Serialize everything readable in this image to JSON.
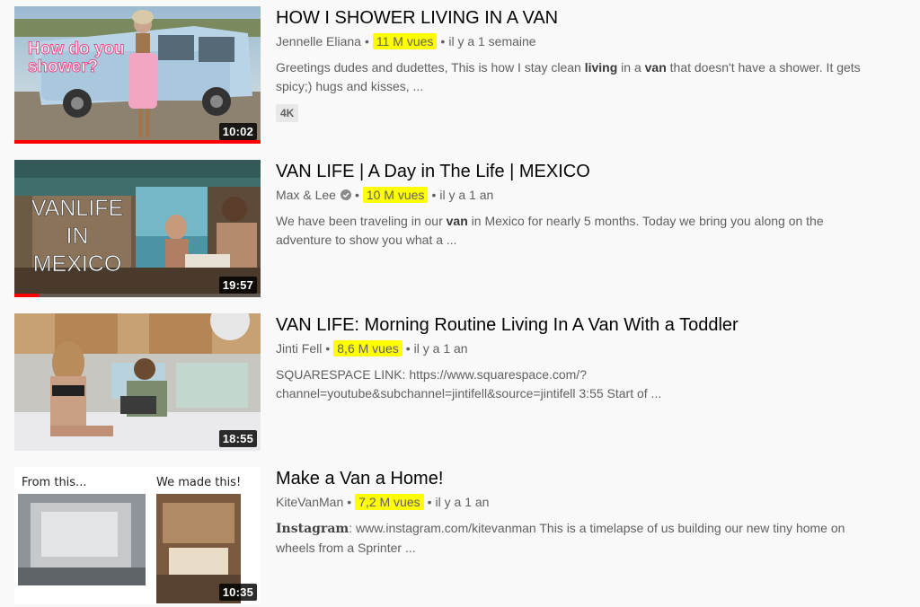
{
  "results": [
    {
      "title": "HOW I SHOWER LIVING IN A VAN",
      "channel": "Jennelle Eliana",
      "verified": false,
      "views": "11 M vues",
      "age": "il y a 1 semaine",
      "desc_parts": [
        "Greetings dudes and dudettes, This is how I stay clean ",
        "living",
        " in a ",
        "van",
        " that doesn't have a shower. It gets spicy;) hugs and kisses, ..."
      ],
      "badge": "4K",
      "duration": "10:02",
      "progress": 1.0,
      "thumb_caption": "How do you shower?",
      "thumb_caption_lines": [
        "How do you",
        "shower?"
      ]
    },
    {
      "title": "VAN LIFE | A Day in The Life | MEXICO",
      "channel": "Max & Lee",
      "verified": true,
      "views": "10 M vues",
      "age": "il y a 1 an",
      "desc_parts": [
        "We have been traveling in our ",
        "van",
        " in Mexico for nearly 5 months. Today we bring you along on the adventure to show you what a ..."
      ],
      "duration": "19:57",
      "progress": 0.1,
      "thumb_caption_lines": [
        "VANLIFE",
        "IN",
        "MEXICO"
      ]
    },
    {
      "title": "VAN LIFE: Morning Routine Living In A Van With a Toddler",
      "channel": "Jinti Fell",
      "verified": false,
      "views": "8,6 M vues",
      "age": "il y a 1 an",
      "desc_line1": "SQUARESPACE LINK: https://www.squarespace.com/?",
      "desc_line2": "channel=youtube&subchannel=jintifell&source=jintifell 3:55 Start of ...",
      "duration": "18:55"
    },
    {
      "title": "Make a Van a Home!",
      "channel": "KiteVanMan",
      "verified": false,
      "views": "7,2 M vues",
      "age": "il y a 1 an",
      "desc_label": "Instagram",
      "desc_rest": ": www.instagram.com/kitevanman This is a timelapse of us building our new tiny home on wheels from a Sprinter ...",
      "duration": "10:35",
      "thumb_left_caption": "From this...",
      "thumb_right_caption": "We made this!"
    }
  ],
  "separator": "•",
  "colors": {
    "highlight": "#ffff00",
    "progress": "#ff0000",
    "meta": "#606060"
  }
}
